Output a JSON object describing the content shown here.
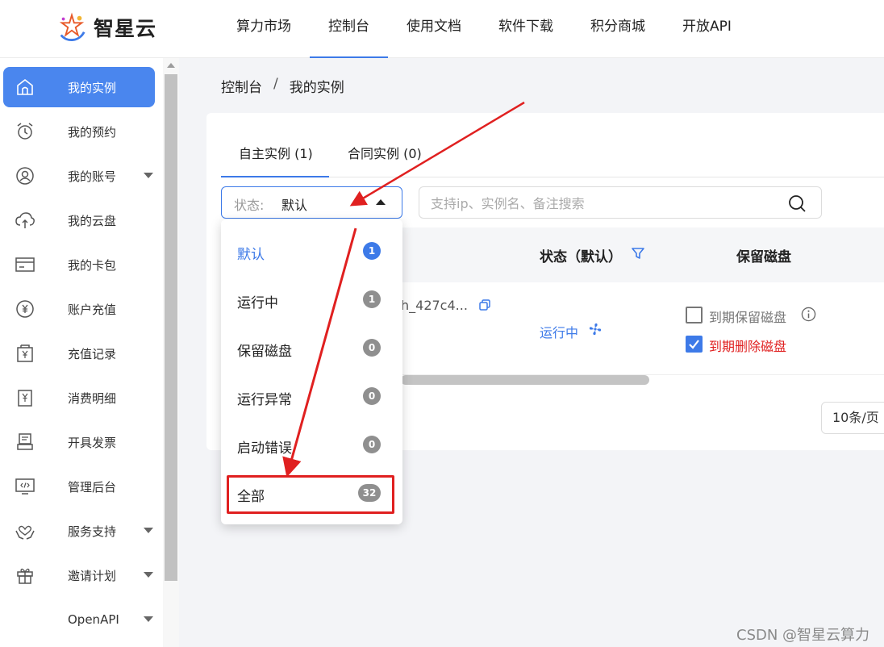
{
  "brand": {
    "name": "智星云"
  },
  "topnav": [
    "算力市场",
    "控制台",
    "使用文档",
    "软件下载",
    "积分商城",
    "开放API"
  ],
  "sidebar": {
    "items": [
      {
        "label": "我的实例",
        "icon": "home-icon",
        "active": true,
        "caret": false
      },
      {
        "label": "我的预约",
        "icon": "alarm-clock-icon",
        "active": false,
        "caret": false
      },
      {
        "label": "我的账号",
        "icon": "user-icon",
        "active": false,
        "caret": true
      },
      {
        "label": "我的云盘",
        "icon": "cloud-upload-icon",
        "active": false,
        "caret": false
      },
      {
        "label": "我的卡包",
        "icon": "card-icon",
        "active": false,
        "caret": false
      },
      {
        "label": "账户充值",
        "icon": "yuan-coin-icon",
        "active": false,
        "caret": false
      },
      {
        "label": "充值记录",
        "icon": "recharge-record-icon",
        "active": false,
        "caret": false
      },
      {
        "label": "消费明细",
        "icon": "bill-icon",
        "active": false,
        "caret": false
      },
      {
        "label": "开具发票",
        "icon": "invoice-icon",
        "active": false,
        "caret": false
      },
      {
        "label": "管理后台",
        "icon": "monitor-code-icon",
        "active": false,
        "caret": false
      },
      {
        "label": "服务支持",
        "icon": "hands-heart-icon",
        "active": false,
        "caret": true
      },
      {
        "label": "邀请计划",
        "icon": "gift-icon",
        "active": false,
        "caret": true
      },
      {
        "label": "OpenAPI",
        "icon": "",
        "active": false,
        "caret": true
      }
    ]
  },
  "breadcrumb": {
    "root": "控制台",
    "sep": "/",
    "current": "我的实例"
  },
  "tabs": [
    {
      "label": "自主实例 (1)",
      "active": true
    },
    {
      "label": "合同实例 (0)",
      "active": false
    }
  ],
  "status_select": {
    "prefix": "状态:",
    "value": "默认"
  },
  "search": {
    "placeholder": "支持ip、实例名、备注搜索"
  },
  "table": {
    "headers": {
      "status": "状态（默认）",
      "disk": "保留磁盘"
    },
    "row": {
      "name": "h_427c4...",
      "status": "运行中",
      "keep_disk_label": "到期保留磁盘",
      "keep_disk_checked": false,
      "delete_disk_label": "到期删除磁盘",
      "delete_disk_checked": true
    }
  },
  "pagination": {
    "page_size": "10条/页"
  },
  "dropdown": {
    "options": [
      {
        "label": "默认",
        "count": "1",
        "selected": true
      },
      {
        "label": "运行中",
        "count": "1",
        "selected": false
      },
      {
        "label": "保留磁盘",
        "count": "0",
        "selected": false
      },
      {
        "label": "运行异常",
        "count": "0",
        "selected": false
      },
      {
        "label": "启动错误",
        "count": "0",
        "selected": false
      },
      {
        "label": "全部",
        "count": "32",
        "selected": false
      }
    ]
  },
  "colors": {
    "accent": "#3d7ae8",
    "danger": "#e02020",
    "annotation": "#e02020"
  },
  "watermark": "CSDN @智星云算力"
}
